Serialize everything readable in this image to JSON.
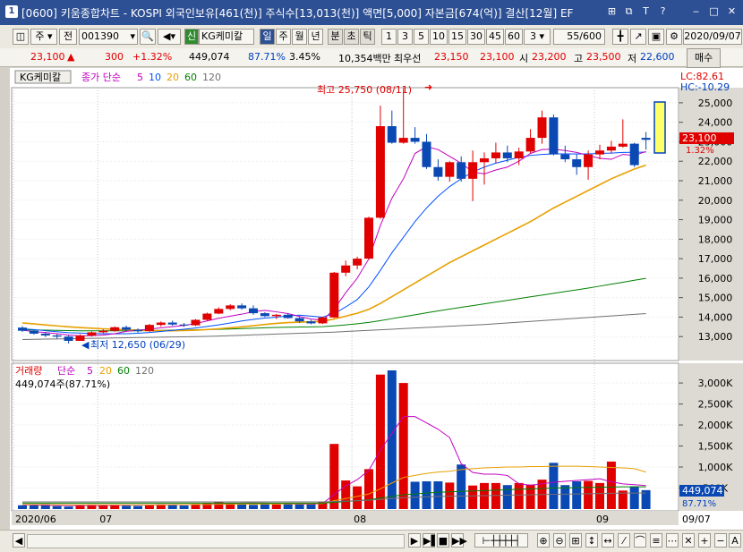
{
  "window": {
    "icon_label": "1",
    "title": "[0600] 키움종합차트 - KOSPI 외국인보유[461(천)] 주식수[13,013(천)] 액면[5,000] 자본금[674(억)] 결산[12월] EF",
    "buttons": [
      "⊞",
      "⧉",
      "T",
      "?",
      "‒",
      "□",
      "✕"
    ]
  },
  "toolbar": {
    "type_label": "주",
    "prev_label": "전",
    "code": "001390",
    "credit_badge": "신",
    "stock_name": "KG케미칼",
    "periods": [
      "일",
      "주",
      "월",
      "년",
      "분",
      "초",
      "틱"
    ],
    "period_selected": "일",
    "intervals": [
      "1",
      "3",
      "5",
      "10",
      "15",
      "30",
      "45",
      "60"
    ],
    "interval_dropdown": "3",
    "count": "55/600",
    "date": "2020/09/07"
  },
  "quote": {
    "price": "23,100",
    "change_arrow": "▲",
    "change": "300",
    "change_pct": "+1.32%",
    "volume": "449,074",
    "volume_ratio": "87.71%",
    "turnover": "3.45%",
    "amount": "10,354백만",
    "preferred_label": "최우선",
    "ask": "23,150",
    "bid": "23,100",
    "open_label": "시",
    "open": "23,200",
    "high_label": "고",
    "high": "23,500",
    "low_label": "저",
    "low": "22,600",
    "buy_button": "매수"
  },
  "price_panel": {
    "legend_stock": "KG케미칼",
    "legend_prefix": "종가 단순",
    "ma_periods": [
      "5",
      "10",
      "20",
      "60",
      "120"
    ],
    "ma_colors": [
      "#c000c0",
      "#0050ff",
      "#e8a000",
      "#008000",
      "#707070"
    ],
    "lc_label": "LC:82.61",
    "hc_label": "HC:-10.29",
    "high_annotation": "최고 25,750 (08/11)",
    "low_annotation": "최저 12,650 (06/29)",
    "current_price_label": "23,100",
    "current_pct_label": "1.32%",
    "y_min": 12000,
    "y_max": 25500,
    "y_ticks": [
      "25,000",
      "24,000",
      "23,000",
      "22,000",
      "21,000",
      "20,000",
      "19,000",
      "18,000",
      "17,000",
      "16,000",
      "15,000",
      "14,000",
      "13,000"
    ]
  },
  "volume_panel": {
    "legend_prefix": "거래량",
    "legend_ma": "단순",
    "ma_periods": [
      "5",
      "20",
      "60",
      "120"
    ],
    "info": "449,074주(87.71%)",
    "y_ticks": [
      "3,000K",
      "2,500K",
      "2,000K",
      "1,500K",
      "1,000K",
      "500K"
    ],
    "current_label": "449,074",
    "current_pct_label": "87.71%",
    "y_max": 3300
  },
  "x_axis": {
    "ticks": [
      "2020/06",
      "07",
      "08",
      "09"
    ],
    "right_label": "09/07"
  },
  "chart_data": {
    "type": "candlestick",
    "unit": "KRW",
    "candles": [
      [
        13460,
        13530,
        13240,
        13300
      ],
      [
        13300,
        13320,
        13100,
        13150
      ],
      [
        13150,
        13220,
        12980,
        13060
      ],
      [
        13060,
        13120,
        12900,
        13000
      ],
      [
        13000,
        13050,
        12650,
        12780
      ],
      [
        12780,
        13120,
        12780,
        13050
      ],
      [
        13050,
        13260,
        13000,
        13220
      ],
      [
        13220,
        13380,
        13150,
        13300
      ],
      [
        13300,
        13520,
        13250,
        13480
      ],
      [
        13480,
        13560,
        13300,
        13350
      ],
      [
        13350,
        13420,
        13200,
        13280
      ],
      [
        13280,
        13650,
        13250,
        13600
      ],
      [
        13600,
        13780,
        13520,
        13720
      ],
      [
        13720,
        13820,
        13560,
        13620
      ],
      [
        13620,
        13700,
        13500,
        13580
      ],
      [
        13580,
        13900,
        13540,
        13860
      ],
      [
        13860,
        14230,
        13820,
        14180
      ],
      [
        14180,
        14500,
        14150,
        14420
      ],
      [
        14420,
        14660,
        14350,
        14600
      ],
      [
        14600,
        14700,
        14380,
        14450
      ],
      [
        14450,
        14600,
        14120,
        14200
      ],
      [
        14200,
        14250,
        14010,
        14050
      ],
      [
        14050,
        14160,
        13900,
        14120
      ],
      [
        14120,
        14200,
        13920,
        13950
      ],
      [
        13950,
        14020,
        13700,
        13780
      ],
      [
        13780,
        13860,
        13630,
        13680
      ],
      [
        13680,
        14020,
        13650,
        13980
      ],
      [
        13980,
        16320,
        13950,
        16280
      ],
      [
        16280,
        16900,
        16100,
        16650
      ],
      [
        16650,
        17100,
        16450,
        17000
      ],
      [
        17000,
        19150,
        16950,
        19100
      ],
      [
        19100,
        24850,
        19050,
        23800
      ],
      [
        23800,
        24600,
        22900,
        22950
      ],
      [
        22950,
        25750,
        22900,
        23200
      ],
      [
        23200,
        23750,
        22900,
        23000
      ],
      [
        23000,
        23400,
        21600,
        21700
      ],
      [
        21700,
        22100,
        21000,
        21200
      ],
      [
        21200,
        22000,
        20950,
        21950
      ],
      [
        21950,
        22250,
        20950,
        21100
      ],
      [
        21100,
        22550,
        19950,
        21950
      ],
      [
        21950,
        22450,
        20800,
        22150
      ],
      [
        22150,
        22950,
        21900,
        22450
      ],
      [
        22450,
        22800,
        21950,
        22150
      ],
      [
        22150,
        22700,
        21800,
        22500
      ],
      [
        22500,
        23650,
        22400,
        23200
      ],
      [
        23200,
        24600,
        22900,
        24250
      ],
      [
        24250,
        24400,
        22300,
        22350
      ],
      [
        22350,
        22800,
        21950,
        22100
      ],
      [
        22100,
        22350,
        21300,
        21700
      ],
      [
        21700,
        22550,
        21050,
        22350
      ],
      [
        22350,
        22850,
        22100,
        22550
      ],
      [
        22550,
        23050,
        22400,
        22750
      ],
      [
        22750,
        24150,
        22700,
        22900
      ],
      [
        22900,
        22950,
        21700,
        21800
      ],
      [
        23200,
        23500,
        22600,
        23100
      ]
    ],
    "ma": {
      "5": [
        13330,
        13250,
        13210,
        13150,
        13080,
        13040,
        13050,
        13080,
        13150,
        13270,
        13330,
        13380,
        13450,
        13510,
        13570,
        13670,
        13800,
        13940,
        14050,
        14150,
        14280,
        14350,
        14270,
        14180,
        14030,
        13900,
        13840,
        14410,
        15250,
        16000,
        16990,
        18700,
        20100,
        21100,
        22400,
        22750,
        22600,
        22250,
        21900,
        21450,
        21350,
        21550,
        21700,
        22000,
        22400,
        22600,
        22620,
        22550,
        22450,
        22300,
        22150,
        22100,
        22350,
        22300,
        22500
      ],
      "10": [
        13400,
        13360,
        13300,
        13250,
        13200,
        13180,
        13160,
        13150,
        13140,
        13150,
        13170,
        13210,
        13260,
        13320,
        13380,
        13440,
        13520,
        13600,
        13700,
        13800,
        13880,
        13950,
        14000,
        14060,
        14100,
        14050,
        14000,
        14180,
        14520,
        14900,
        15550,
        16400,
        17300,
        18100,
        18900,
        19600,
        20200,
        20700,
        21100,
        21450,
        21700,
        21900,
        22050,
        22200,
        22300,
        22350,
        22380,
        22380,
        22370,
        22380,
        22400,
        22420,
        22450,
        22460,
        22470
      ],
      "20": [
        13700,
        13650,
        13600,
        13550,
        13500,
        13460,
        13430,
        13400,
        13370,
        13350,
        13330,
        13310,
        13300,
        13300,
        13310,
        13330,
        13360,
        13400,
        13450,
        13500,
        13560,
        13620,
        13680,
        13720,
        13740,
        13760,
        13790,
        13900,
        14050,
        14200,
        14400,
        14700,
        15050,
        15400,
        15750,
        16100,
        16450,
        16800,
        17100,
        17400,
        17700,
        18000,
        18300,
        18600,
        18900,
        19250,
        19600,
        19900,
        20200,
        20500,
        20800,
        21100,
        21350,
        21600,
        21800
      ],
      "60": [
        13350,
        13340,
        13330,
        13320,
        13310,
        13300,
        13300,
        13300,
        13300,
        13300,
        13300,
        13310,
        13320,
        13330,
        13340,
        13350,
        13360,
        13370,
        13390,
        13410,
        13430,
        13450,
        13470,
        13480,
        13490,
        13500,
        13510,
        13550,
        13600,
        13660,
        13730,
        13820,
        13920,
        14020,
        14120,
        14220,
        14320,
        14410,
        14500,
        14590,
        14680,
        14770,
        14860,
        14950,
        15040,
        15130,
        15220,
        15310,
        15400,
        15490,
        15590,
        15690,
        15790,
        15890,
        15990
      ],
      "120": [
        12850,
        12860,
        12870,
        12880,
        12890,
        12900,
        12910,
        12920,
        12930,
        12940,
        12950,
        12960,
        12970,
        12980,
        12990,
        13000,
        13010,
        13030,
        13050,
        13070,
        13090,
        13110,
        13130,
        13150,
        13170,
        13190,
        13210,
        13230,
        13260,
        13290,
        13320,
        13350,
        13380,
        13410,
        13440,
        13470,
        13500,
        13530,
        13560,
        13590,
        13620,
        13660,
        13700,
        13740,
        13780,
        13820,
        13860,
        13900,
        13940,
        13980,
        14020,
        14060,
        14100,
        14140,
        14180
      ]
    },
    "volume_k": [
      90,
      85,
      120,
      70,
      60,
      95,
      110,
      100,
      90,
      80,
      75,
      100,
      115,
      95,
      85,
      120,
      140,
      180,
      150,
      120,
      100,
      130,
      110,
      120,
      130,
      125,
      160,
      1550,
      680,
      540,
      950,
      3200,
      3300,
      3000,
      650,
      660,
      660,
      630,
      1060,
      560,
      620,
      620,
      570,
      620,
      580,
      700,
      1100,
      570,
      660,
      670,
      620,
      1130,
      440,
      540,
      450
    ],
    "volume_ma_k": {
      "5": [
        100,
        95,
        90,
        88,
        85,
        86,
        87,
        88,
        90,
        92,
        95,
        97,
        100,
        102,
        104,
        106,
        110,
        120,
        130,
        140,
        145,
        140,
        130,
        125,
        120,
        118,
        130,
        350,
        550,
        700,
        920,
        1400,
        1800,
        2200,
        2200,
        2050,
        1900,
        1700,
        1080,
        870,
        830,
        830,
        800,
        600,
        570,
        600,
        640,
        660,
        680,
        700,
        720,
        650,
        600,
        580,
        560
      ],
      "20": [
        110,
        108,
        106,
        104,
        102,
        100,
        100,
        100,
        100,
        100,
        100,
        100,
        102,
        104,
        106,
        108,
        110,
        112,
        114,
        116,
        118,
        120,
        122,
        124,
        126,
        128,
        130,
        200,
        250,
        300,
        360,
        480,
        620,
        750,
        800,
        850,
        880,
        900,
        940,
        960,
        980,
        990,
        1000,
        1000,
        1010,
        1010,
        1020,
        1020,
        1020,
        1010,
        1000,
        990,
        980,
        960,
        880
      ],
      "60": [
        140,
        140,
        140,
        140,
        140,
        140,
        140,
        140,
        140,
        140,
        140,
        140,
        140,
        140,
        140,
        140,
        140,
        140,
        140,
        140,
        140,
        140,
        140,
        140,
        140,
        140,
        140,
        160,
        180,
        200,
        220,
        260,
        300,
        340,
        360,
        380,
        400,
        410,
        420,
        430,
        440,
        450,
        460,
        470,
        480,
        490,
        500,
        505,
        510,
        515,
        520,
        525,
        530,
        530,
        530
      ],
      "120": [
        170,
        170,
        170,
        170,
        170,
        170,
        170,
        170,
        170,
        170,
        170,
        170,
        170,
        170,
        170,
        170,
        170,
        170,
        170,
        170,
        170,
        170,
        170,
        170,
        170,
        170,
        170,
        180,
        190,
        200,
        210,
        230,
        250,
        270,
        280,
        290,
        300,
        305,
        310,
        315,
        320,
        325,
        330,
        335,
        340,
        345,
        350,
        355,
        360,
        365,
        370,
        375,
        380,
        380,
        380
      ]
    }
  }
}
